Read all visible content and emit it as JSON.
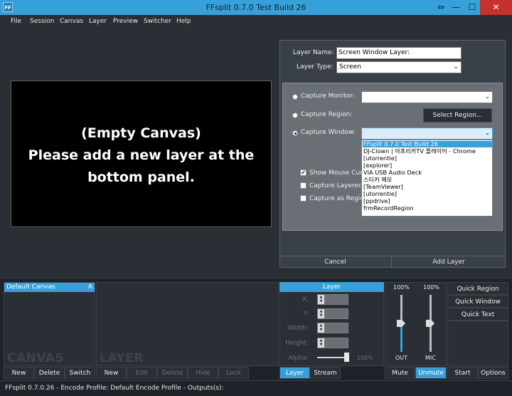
{
  "window": {
    "icon_text": "FF",
    "title": "FFsplit 0.7.0 Test Build 26",
    "restore_glyph": "⇔",
    "minimize_glyph": "—",
    "maximize_glyph": "☐",
    "close_glyph": "✕"
  },
  "menu": [
    "File",
    "Session",
    "Canvas",
    "Layer",
    "Preview",
    "Switcher",
    "Help"
  ],
  "preview": {
    "empty_message": "(Empty Canvas)\nPlease add a new layer at the\nbottom panel."
  },
  "layer_props": {
    "name_label": "Layer Name:",
    "name_value": "Screen Window Layer:",
    "type_label": "Layer Type:",
    "type_value": "Screen",
    "capture_monitor_label": "Capture Monitor:",
    "capture_monitor_value": "",
    "capture_region_label": "Capture Region:",
    "select_region_label": "Select Region...",
    "capture_window_label": "Capture Window:",
    "capture_window_value": "",
    "show_mouse_label": "Show Mouse Curso",
    "show_mouse_checked": true,
    "capture_layered_label": "Capture Layered W",
    "capture_as_region_label": "Capture as Region",
    "window_options": [
      "FFsplit 0.7.0 Test Build 26",
      "DJ-Clown | 아프리카TV 플레이어 - Chrome",
      "[utorrentie]",
      "[explorer]",
      "VIA USB Audio Deck",
      "스티커 메모",
      "[TeamViewer]",
      "[utorrentie]",
      "[ppdrive]",
      "frmRecordRegion"
    ],
    "cancel_label": "Cancel",
    "add_layer_label": "Add Layer"
  },
  "canvas_panel": {
    "item_name": "Default Canvas",
    "item_badge": "A",
    "watermark": "CANVAS",
    "buttons": [
      "New",
      "Delete",
      "Switch"
    ]
  },
  "layer_panel": {
    "watermark": "LAYER",
    "buttons": [
      "New",
      "Edit",
      "Delete",
      "Hide",
      "Lock"
    ]
  },
  "layer_settings": {
    "header": "Layer",
    "x_label": "X:",
    "y_label": "Y:",
    "width_label": "Width:",
    "height_label": "Height:",
    "alpha_label": "Alpha:",
    "alpha_value": "100%",
    "alpha_fraction": 1.0,
    "tab_layer": "Layer",
    "tab_stream": "Stream"
  },
  "audio": {
    "out_level": "100%",
    "mic_level": "100%",
    "out_fraction": 1.0,
    "mic_fraction": 1.0,
    "out_label": "OUT",
    "mic_label": "MIC",
    "mute_label": "Mute",
    "unmute_label": "Unmute"
  },
  "quick": {
    "region": "Quick Region",
    "window": "Quick Window",
    "text": "Quick Text",
    "start": "Start",
    "options": "Options"
  },
  "status": "FFsplit 0.7.0.26 - Encode Profile: Default Encode Profile - Outputs(s):",
  "colors": {
    "accent": "#38a0d8",
    "close": "#c7312b",
    "panel": "#2a2f35"
  }
}
